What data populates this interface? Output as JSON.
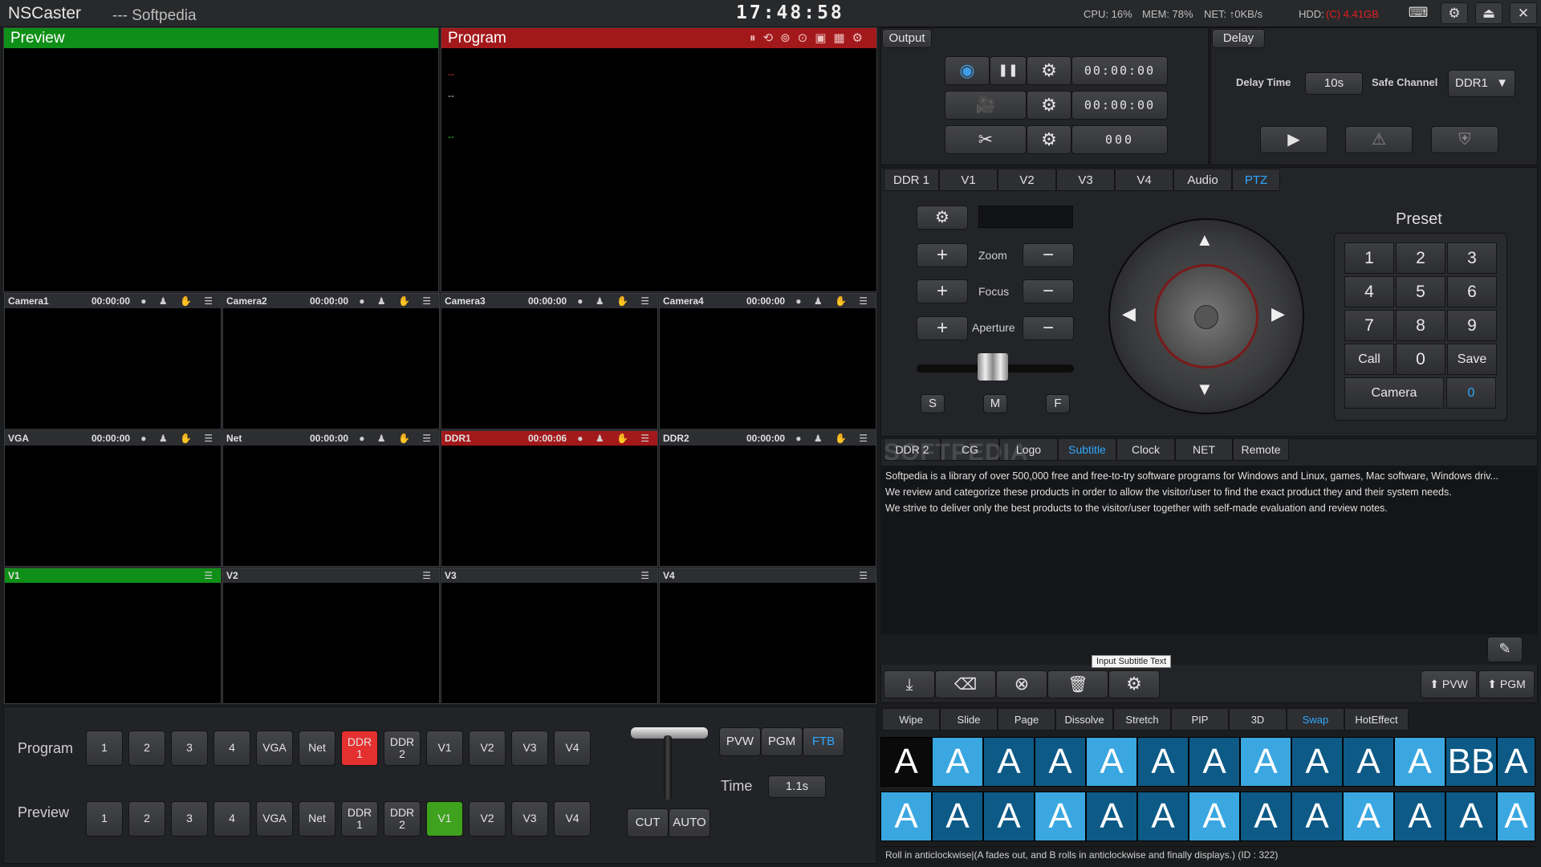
{
  "title_bar": {
    "app_name": "NSCaster",
    "subtitle": "--- Softpedia",
    "clock": "17:48:58",
    "cpu": "CPU: 16%",
    "mem": "MEM: 78%",
    "net": "NET: ↑0KB/s",
    "hdd_label": "HDD:",
    "hdd_value": "(C) 4.41GB"
  },
  "preview_label": "Preview",
  "program_label": "Program",
  "program_overlay": [
    "--",
    "--",
    "--"
  ],
  "cells": [
    {
      "name": "Camera1",
      "time": "00:00:00"
    },
    {
      "name": "Camera2",
      "time": "00:00:00"
    },
    {
      "name": "Camera3",
      "time": "00:00:00"
    },
    {
      "name": "Camera4",
      "time": "00:00:00"
    },
    {
      "name": "VGA",
      "time": "00:00:00"
    },
    {
      "name": "Net",
      "time": "00:00:00"
    },
    {
      "name": "DDR1",
      "time": "00:00:06"
    },
    {
      "name": "DDR2",
      "time": "00:00:00"
    },
    {
      "name": "V1",
      "time": ""
    },
    {
      "name": "V2",
      "time": ""
    },
    {
      "name": "V3",
      "time": ""
    },
    {
      "name": "V4",
      "time": ""
    }
  ],
  "output": {
    "label": "Output",
    "record_time": "00:00:00",
    "stream_time": "00:00:00",
    "clip_count": "000"
  },
  "delay": {
    "label": "Delay",
    "delay_time_label": "Delay Time",
    "delay_time_value": "10s",
    "safe_channel_label": "Safe Channel",
    "safe_channel_value": "DDR1"
  },
  "source_tabs": [
    "DDR 1",
    "V1",
    "V2",
    "V3",
    "V4",
    "Audio",
    "PTZ"
  ],
  "ptz": {
    "zoom": "Zoom",
    "focus": "Focus",
    "aperture": "Aperture",
    "speed": [
      "S",
      "M",
      "F"
    ],
    "preset_title": "Preset",
    "keys": [
      "1",
      "2",
      "3",
      "4",
      "5",
      "6",
      "7",
      "8",
      "9",
      "Call",
      "0",
      "Save"
    ],
    "camera_label": "Camera",
    "camera_value": "0"
  },
  "overlay_tabs": [
    "DDR 2",
    "CG",
    "Logo",
    "Subtitle",
    "Clock",
    "NET",
    "Remote"
  ],
  "watermark": "SOFTPEDIA",
  "subtitle_lines": [
    "Softpedia is a library of over 500,000 free and free-to-try software programs for Windows and Linux, games, Mac software, Windows driv...",
    "We review and categorize these products in order to allow the visitor/user to find the exact product they and their system needs.",
    "We strive to deliver only the best products to the visitor/user together with self-made evaluation and review notes."
  ],
  "tooltip": "Input Subtitle Text",
  "push_pvw": "PVW",
  "push_pgm": "PGM",
  "transition_tabs": [
    "Wipe",
    "Slide",
    "Page",
    "Dissolve",
    "Stretch",
    "PIP",
    "3D",
    "Swap",
    "HotEffect"
  ],
  "status_text": "Roll in anticlockwise|(A fades out, and B rolls in anticlockwise and finally displays.) (ID : 322)",
  "program_row": {
    "label": "Program",
    "buttons": [
      "1",
      "2",
      "3",
      "4",
      "VGA",
      "Net",
      "DDR\n1",
      "DDR\n2",
      "V1",
      "V2",
      "V3",
      "V4"
    ]
  },
  "preview_row": {
    "label": "Preview",
    "buttons": [
      "1",
      "2",
      "3",
      "4",
      "VGA",
      "Net",
      "DDR\n1",
      "DDR\n2",
      "V1",
      "V2",
      "V3",
      "V4"
    ]
  },
  "switcher": {
    "pvw": "PVW",
    "pgm": "PGM",
    "ftb": "FTB",
    "time_label": "Time",
    "time_value": "1.1s",
    "cut": "CUT",
    "auto": "AUTO"
  },
  "colors": {
    "preview_green": "#0f8f17",
    "program_red": "#a3191b",
    "active_blue": "#2ea8ff",
    "ddr_red": "#e53030",
    "v1_green": "#3fa21f"
  }
}
